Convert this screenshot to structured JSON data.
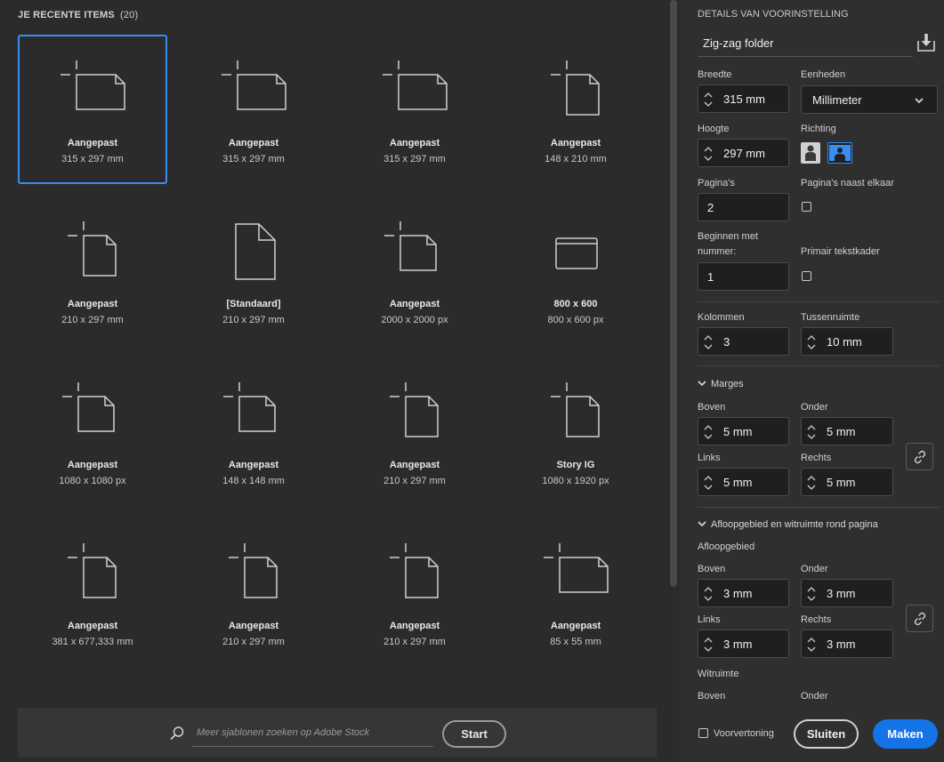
{
  "left": {
    "heading": "JE RECENTE ITEMS",
    "count": "(20)",
    "items": [
      {
        "name": "Aangepast",
        "size": "315 x 297 mm"
      },
      {
        "name": "Aangepast",
        "size": "315 x 297 mm"
      },
      {
        "name": "Aangepast",
        "size": "315 x 297 mm"
      },
      {
        "name": "Aangepast",
        "size": "148 x 210 mm"
      },
      {
        "name": "Aangepast",
        "size": "210 x 297 mm"
      },
      {
        "name": "[Standaard]",
        "size": "210 x 297 mm"
      },
      {
        "name": "Aangepast",
        "size": "2000 x 2000 px"
      },
      {
        "name": "800 x 600",
        "size": "800 x 600 px"
      },
      {
        "name": "Aangepast",
        "size": "1080 x 1080 px"
      },
      {
        "name": "Aangepast",
        "size": "148 x 148 mm"
      },
      {
        "name": "Aangepast",
        "size": "210 x 297 mm"
      },
      {
        "name": "Story IG",
        "size": "1080 x 1920 px"
      },
      {
        "name": "Aangepast",
        "size": "381 x 677,333 mm"
      },
      {
        "name": "Aangepast",
        "size": "210 x 297 mm"
      },
      {
        "name": "Aangepast",
        "size": "210 x 297 mm"
      },
      {
        "name": "Aangepast",
        "size": "85 x 55 mm"
      }
    ],
    "search_placeholder": "Meer sjablonen zoeken op Adobe Stock",
    "start_label": "Start"
  },
  "right": {
    "title": "DETAILS VAN VOORINSTELLING",
    "preset_name": "Zig-zag folder",
    "breedte_label": "Breedte",
    "breedte": "315 mm",
    "eenheden_label": "Eenheden",
    "eenheden": "Millimeter",
    "hoogte_label": "Hoogte",
    "hoogte": "297 mm",
    "richting_label": "Richting",
    "paginas_label": "Pagina's",
    "paginas": "2",
    "naast_label": "Pagina's naast elkaar",
    "beginnen_label_1": "Beginnen met",
    "beginnen_label_2": "nummer:",
    "beginnen": "1",
    "primair_label": "Primair tekstkader",
    "kolommen_label": "Kolommen",
    "kolommen": "3",
    "tussenruimte_label": "Tussenruimte",
    "tussenruimte": "10 mm",
    "marges_label": "Marges",
    "marges": {
      "boven_label": "Boven",
      "boven": "5 mm",
      "onder_label": "Onder",
      "onder": "5 mm",
      "links_label": "Links",
      "links": "5 mm",
      "rechts_label": "Rechts",
      "rechts": "5 mm"
    },
    "afloop_section": "Afloopgebied en witruimte rond pagina",
    "afloop_label": "Afloopgebied",
    "afloop": {
      "boven_label": "Boven",
      "boven": "3 mm",
      "onder_label": "Onder",
      "onder": "3 mm",
      "links_label": "Links",
      "links": "3 mm",
      "rechts_label": "Rechts",
      "rechts": "3 mm"
    },
    "witruimte_label": "Witruimte",
    "wit_boven_label": "Boven",
    "wit_onder_label": "Onder",
    "voorvertoning_label": "Voorvertoning",
    "sluiten_label": "Sluiten",
    "maken_label": "Maken"
  },
  "colors": {
    "accent": "#1473e6",
    "selection": "#378ef0",
    "panel": "#2f2f2f"
  }
}
